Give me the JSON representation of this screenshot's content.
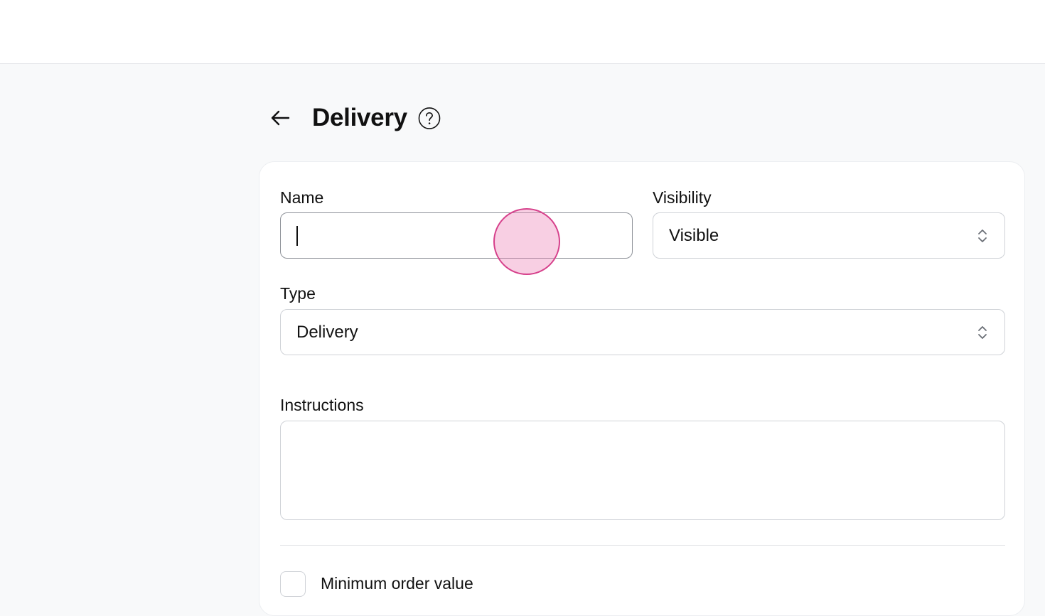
{
  "header": {
    "title": "Delivery",
    "back_icon": "arrow-left-icon",
    "help_icon": "question-circle-icon"
  },
  "form": {
    "name": {
      "label": "Name",
      "value": "",
      "placeholder": ""
    },
    "visibility": {
      "label": "Visibility",
      "selected": "Visible"
    },
    "type": {
      "label": "Type",
      "selected": "Delivery"
    },
    "instructions": {
      "label": "Instructions",
      "value": ""
    },
    "minimum_order": {
      "label": "Minimum order value",
      "checked": false
    }
  },
  "colors": {
    "page_background": "#f8f9fa",
    "card_background": "#ffffff",
    "border": "#cfd2d7",
    "click_indicator": "#d6408b"
  }
}
